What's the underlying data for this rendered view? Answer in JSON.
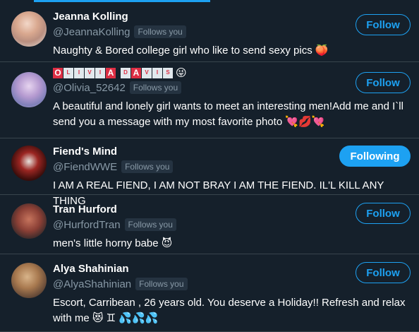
{
  "users": [
    {
      "name": "Jeanna Kolling",
      "handle": "@JeannaKolling",
      "follows_you": "Follows you",
      "bio": "Naughty & Bored college girl who like to send sexy pics 🍑",
      "button": "Follow"
    },
    {
      "name_emoji": "😜",
      "name_letters": [
        "O",
        "L",
        "I",
        "V",
        "I",
        "A",
        "D",
        "A",
        "V",
        "I",
        "S"
      ],
      "handle": "@Olivia_52642",
      "follows_you": "Follows you",
      "bio": "A beautiful and lonely girl wants to meet an interesting men!Add me and I`ll send you a message with my most favorite photo 💘💋💘",
      "button": "Follow"
    },
    {
      "name": "Fiend's Mind",
      "handle": "@FiendWWE",
      "follows_you": "Follows you",
      "bio": "I AM A REAL FIEND, I AM NOT BRAY I AM THE FIEND. IL'L KILL ANY THING",
      "button": "Following"
    },
    {
      "name": "Tran Hurford",
      "handle": "@HurfordTran",
      "follows_you": "Follows you",
      "bio": "men's little horny babe 😈",
      "button": "Follow"
    },
    {
      "name": "Alya Shahinian",
      "handle": "@AlyaShahinian",
      "follows_you": "Follows you",
      "bio": "Escort, Carribean , 26 years old. You deserve a Holiday!! Refresh and relax with me 😻 ♊ 💦💦💦",
      "button": "Follow"
    }
  ],
  "colors": {
    "background": "#15202b",
    "accent": "#1da1f2",
    "secondary_text": "#8899a6",
    "divider": "#38444d"
  }
}
